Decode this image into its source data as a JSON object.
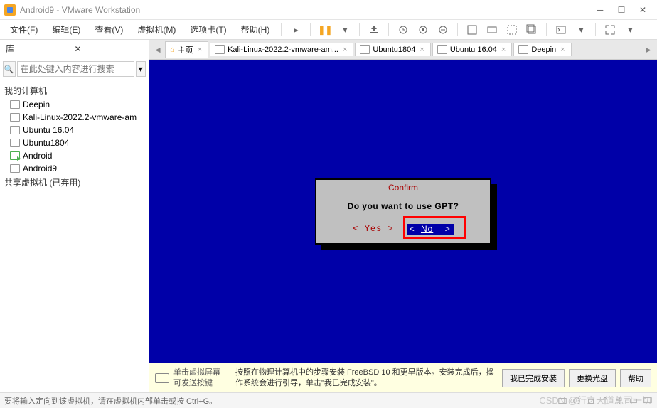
{
  "window": {
    "title": "Android9 - VMware Workstation"
  },
  "menu": {
    "file": "文件(F)",
    "edit": "编辑(E)",
    "view": "查看(V)",
    "vm": "虚拟机(M)",
    "tabs": "选项卡(T)",
    "help": "帮助(H)"
  },
  "sidebar": {
    "title": "库",
    "search_placeholder": "在此处键入内容进行搜索",
    "root": "我的计算机",
    "items": [
      {
        "label": "Deepin",
        "running": false
      },
      {
        "label": "Kali-Linux-2022.2-vmware-am",
        "running": false
      },
      {
        "label": "Ubuntu 16.04",
        "running": false
      },
      {
        "label": "Ubuntu1804",
        "running": false
      },
      {
        "label": "Android",
        "running": true
      },
      {
        "label": "Android9",
        "running": false
      }
    ],
    "shared": "共享虚拟机 (已弃用)"
  },
  "tabs": {
    "home": "主页",
    "items": [
      {
        "label": "Kali-Linux-2022.2-vmware-am..."
      },
      {
        "label": "Ubuntu1804"
      },
      {
        "label": "Ubuntu 16.04"
      },
      {
        "label": "Deepin"
      }
    ]
  },
  "dialog": {
    "title": "Confirm",
    "message": "Do you want to use GPT?",
    "yes": "< Yes >",
    "no_open": "<",
    "no_text": "No",
    "no_close": ">"
  },
  "hint": {
    "click_title": "单击虚拟屏幕",
    "click_sub": "可发送按键",
    "main": "按照在物理计算机中的步骤安装 FreeBSD 10 和更早版本。安装完成后，操作系统会进行引导，单击\"我已完成安装\"。",
    "btn_done": "我已完成安装",
    "btn_change": "更换光盘",
    "btn_help": "帮助"
  },
  "status": {
    "text": "要将输入定向到该虚拟机，请在虚拟机内部单击或按 Ctrl+G。"
  },
  "watermark": "CSDN @行之天道总司一切"
}
